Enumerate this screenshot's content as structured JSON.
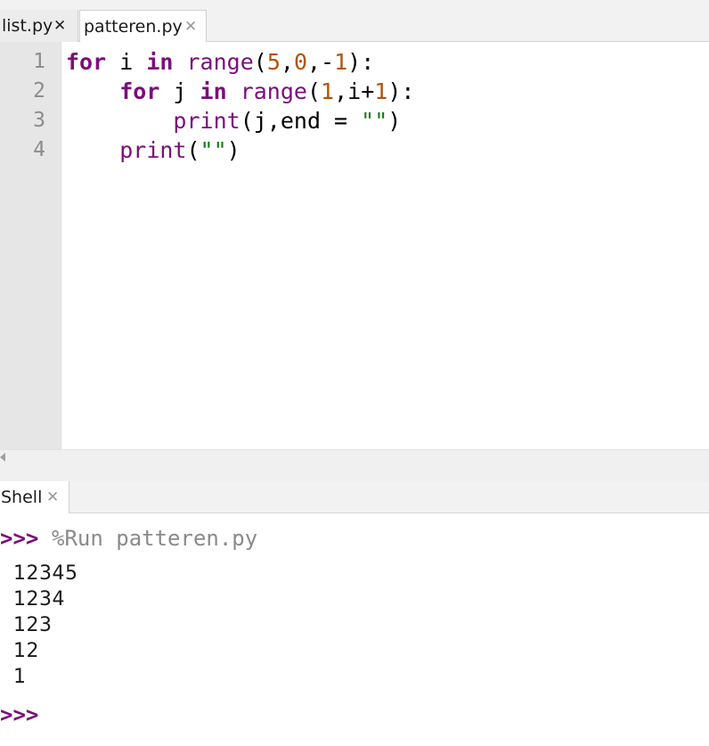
{
  "editor_tabs": [
    {
      "label": "list.py",
      "close": "✕"
    },
    {
      "label": "patteren.py",
      "close": "✕"
    }
  ],
  "code": {
    "line_numbers": [
      "1",
      "2",
      "3",
      "4"
    ],
    "lines": [
      {
        "tokens": [
          {
            "text": "for",
            "kind": "kw"
          },
          {
            "text": " i ",
            "kind": "plain"
          },
          {
            "text": "in",
            "kind": "kw"
          },
          {
            "text": " ",
            "kind": "plain"
          },
          {
            "text": "range",
            "kind": "bi"
          },
          {
            "text": "(",
            "kind": "plain"
          },
          {
            "text": "5",
            "kind": "num"
          },
          {
            "text": ",",
            "kind": "plain"
          },
          {
            "text": "0",
            "kind": "num"
          },
          {
            "text": ",-",
            "kind": "plain"
          },
          {
            "text": "1",
            "kind": "num"
          },
          {
            "text": "):",
            "kind": "plain"
          }
        ]
      },
      {
        "tokens": [
          {
            "text": "    ",
            "kind": "plain"
          },
          {
            "text": "for",
            "kind": "kw"
          },
          {
            "text": " j ",
            "kind": "plain"
          },
          {
            "text": "in",
            "kind": "kw"
          },
          {
            "text": " ",
            "kind": "plain"
          },
          {
            "text": "range",
            "kind": "bi"
          },
          {
            "text": "(",
            "kind": "plain"
          },
          {
            "text": "1",
            "kind": "num"
          },
          {
            "text": ",i+",
            "kind": "plain"
          },
          {
            "text": "1",
            "kind": "num"
          },
          {
            "text": "):",
            "kind": "plain"
          }
        ]
      },
      {
        "tokens": [
          {
            "text": "        ",
            "kind": "plain"
          },
          {
            "text": "print",
            "kind": "bi"
          },
          {
            "text": "(j,end = ",
            "kind": "plain"
          },
          {
            "text": "\"\"",
            "kind": "str"
          },
          {
            "text": ")",
            "kind": "plain"
          }
        ]
      },
      {
        "tokens": [
          {
            "text": "    ",
            "kind": "plain"
          },
          {
            "text": "print",
            "kind": "bi"
          },
          {
            "text": "(",
            "kind": "plain"
          },
          {
            "text": "\"\"",
            "kind": "str"
          },
          {
            "text": ")",
            "kind": "plain"
          }
        ]
      }
    ]
  },
  "shell_tab": {
    "label": "Shell",
    "close": "✕"
  },
  "shell": {
    "prompt": ">>>",
    "command": "%Run patteren.py",
    "output": [
      "12345",
      "1234",
      "123",
      "12",
      "1"
    ],
    "final_prompt": ">>>"
  },
  "colors": {
    "keyword": "#7a0e7a",
    "number": "#b45309",
    "string": "#157a15",
    "prompt": "#7a0e7a"
  },
  "icons": {
    "tab_close": "close-icon",
    "scroll_left": "arrow-left-icon"
  }
}
